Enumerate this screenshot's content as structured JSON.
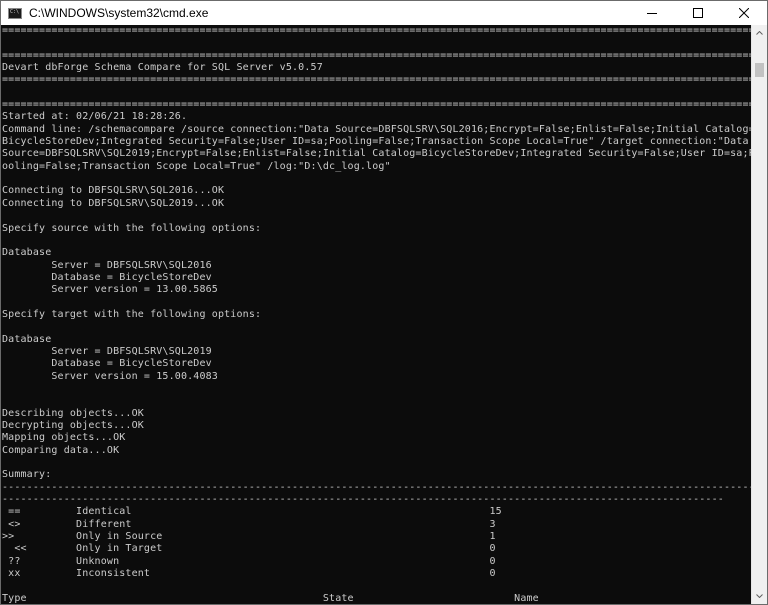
{
  "window": {
    "title": "C:\\WINDOWS\\system32\\cmd.exe",
    "icon_label": "C:\\",
    "icons": {
      "app": "cmd-icon",
      "minimize": "minimize-icon",
      "maximize": "maximize-icon",
      "close": "close-icon"
    }
  },
  "console": {
    "lines": [
      "=============================================================================================================================",
      "",
      "=============================================================================================================================",
      "Devart dbForge Schema Compare for SQL Server v5.0.57",
      "=============================================================================================================================",
      "",
      "=============================================================================================================================",
      "Started at: 02/06/21 18:28:26.",
      "Command line: /schemacompare /source connection:\"Data Source=DBFSQLSRV\\SQL2016;Encrypt=False;Enlist=False;Initial Catalog=",
      "BicycleStoreDev;Integrated Security=False;User ID=sa;Pooling=False;Transaction Scope Local=True\" /target connection:\"Data",
      "Source=DBFSQLSRV\\SQL2019;Encrypt=False;Enlist=False;Initial Catalog=BicycleStoreDev;Integrated Security=False;User ID=sa;P",
      "ooling=False;Transaction Scope Local=True\" /log:\"D:\\dc_log.log\"",
      "",
      "Connecting to DBFSQLSRV\\SQL2016...OK",
      "Connecting to DBFSQLSRV\\SQL2019...OK",
      "",
      "Specify source with the following options:",
      "",
      "Database",
      "        Server = DBFSQLSRV\\SQL2016",
      "        Database = BicycleStoreDev",
      "        Server version = 13.00.5865",
      "",
      "Specify target with the following options:",
      "",
      "Database",
      "        Server = DBFSQLSRV\\SQL2019",
      "        Database = BicycleStoreDev",
      "        Server version = 15.00.4083",
      "",
      "",
      "Describing objects...OK",
      "Decrypting objects...OK",
      "Mapping objects...OK",
      "Comparing data...OK",
      "",
      "Summary:",
      "-----------------------------------------------------------------------------------------------------------------------------",
      "---------------------------------------------------------------------------------------------------------------------",
      " ==         Identical                                                          15",
      " <>         Different                                                          3",
      ">>          Only in Source                                                     1",
      "  <<        Only in Target                                                     0",
      " ??         Unknown                                                            0",
      " xx         Inconsistent                                                       0",
      "",
      "Type                                                State                          Name",
      "-----------------------------------------------------------------------------------------------------------------------------",
      "---------------------------------------------------------------------------------------------------------------------"
    ]
  },
  "scrollbar": {
    "up_icon": "scroll-up-arrow-icon",
    "down_icon": "scroll-down-arrow-icon"
  },
  "colors": {
    "console_background": "#0c0c0c",
    "console_text": "#cccccc",
    "titlebar_background": "#ffffff"
  }
}
